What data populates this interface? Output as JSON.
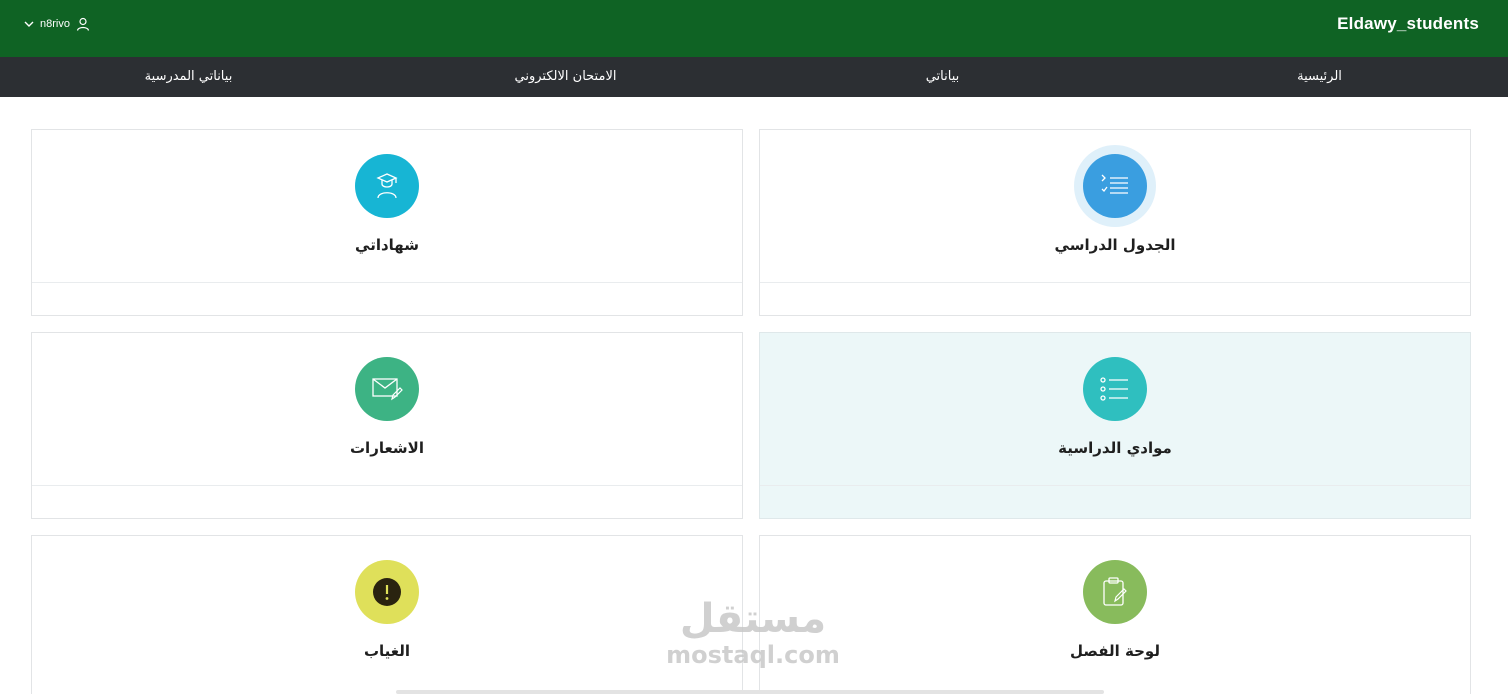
{
  "header": {
    "brand": "Eldawy_students",
    "username": "n8rivo",
    "background": "#0f6324"
  },
  "nav": {
    "items": [
      {
        "label": "الرئيسية"
      },
      {
        "label": "بياناتي"
      },
      {
        "label": "الامتحان الالكتروني"
      },
      {
        "label": "بياناتي المدرسية"
      }
    ]
  },
  "cards": [
    {
      "label": "الجدول الدراسي",
      "icon": "schedule-list-icon",
      "color": "#3a9ee0"
    },
    {
      "label": "شهاداتي",
      "icon": "graduate-icon",
      "color": "#17b5d4"
    },
    {
      "label": "موادي الدراسية",
      "icon": "subjects-list-icon",
      "color": "#2fbfbf"
    },
    {
      "label": "الاشعارات",
      "icon": "mail-edit-icon",
      "color": "#3db384"
    },
    {
      "label": "لوحة الفصل",
      "icon": "clipboard-edit-icon",
      "color": "#88bb5c"
    },
    {
      "label": "الغياب",
      "icon": "alert-icon",
      "color": "#dfe05a"
    }
  ],
  "watermark": {
    "arabic": "مستقل",
    "latin": "mostaql.com"
  }
}
